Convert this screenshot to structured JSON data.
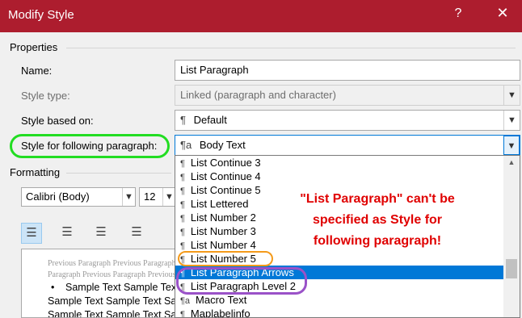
{
  "window": {
    "title": "Modify Style",
    "help_label": "?",
    "close_label": "✕"
  },
  "properties": {
    "group_title": "Properties",
    "name": {
      "label": "Name:",
      "value": "List Paragraph"
    },
    "style_type": {
      "label": "Style type:",
      "value": "Linked (paragraph and character)"
    },
    "style_based_on": {
      "label": "Style based on:",
      "value": "Default"
    },
    "style_following": {
      "label": "Style for following paragraph:",
      "value": "Body Text"
    }
  },
  "formatting": {
    "group_title": "Formatting",
    "font": "Calibri (Body)",
    "size": "12"
  },
  "preview": {
    "previous_line_1": "Previous Paragraph Previous Paragraph Previous Paragraph Previous Paragraph Previous",
    "previous_line_2": "Paragraph Previous Paragraph Previous Paragraph Previous Paragraph Previous Paragraph",
    "bullet": "•",
    "sample_1": "Sample Text Sample Text Sample Text",
    "sample_2": "Sample Text Sample Text Sample Text",
    "sample_3": "Sample Text Sample Text Sample Text"
  },
  "dropdown": {
    "items": [
      {
        "label": "List Continue 3",
        "icon": "paragraph-icon",
        "selected": false
      },
      {
        "label": "List Continue 4",
        "icon": "paragraph-icon",
        "selected": false
      },
      {
        "label": "List Continue 5",
        "icon": "paragraph-icon",
        "selected": false
      },
      {
        "label": "List Lettered",
        "icon": "paragraph-icon",
        "selected": false
      },
      {
        "label": "List Number 2",
        "icon": "paragraph-icon",
        "selected": false
      },
      {
        "label": "List Number 3",
        "icon": "paragraph-icon",
        "selected": false
      },
      {
        "label": "List Number 4",
        "icon": "paragraph-icon",
        "selected": false
      },
      {
        "label": "List Number 5",
        "icon": "paragraph-icon",
        "selected": false
      },
      {
        "label": "List Paragraph Arrows",
        "icon": "paragraph-icon",
        "selected": true
      },
      {
        "label": "List Paragraph Level 2",
        "icon": "paragraph-icon",
        "selected": false
      },
      {
        "label": "Macro Text",
        "icon": "linked-style-icon",
        "selected": false
      },
      {
        "label": "Maplabelinfo",
        "icon": "paragraph-icon",
        "selected": false
      }
    ],
    "scroll_up_label": "▲"
  },
  "annotation": {
    "line_1": "\"List Paragraph\" can't be",
    "line_2": "specified as Style for",
    "line_3": "following paragraph!"
  },
  "colors": {
    "titlebar": "#ad1d2e",
    "selection": "#0078d7",
    "annotation": "#e00000",
    "highlight_green": "#22dd22",
    "highlight_orange": "#f49a1a",
    "highlight_purple": "#9a52c8"
  }
}
